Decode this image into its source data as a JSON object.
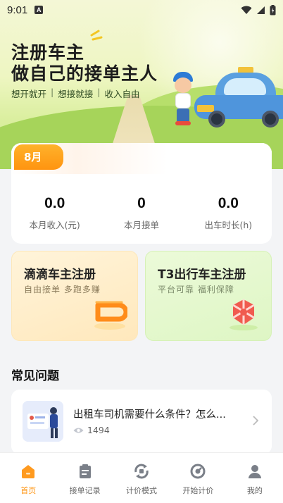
{
  "status_bar": {
    "time": "9:01",
    "notification_icon": "a-icon"
  },
  "hero": {
    "title_line1": "注册车主",
    "title_line2": "做自己的接单主人",
    "tags": [
      "想开就开",
      "想接就接",
      "收入自由"
    ],
    "separator": "|"
  },
  "stats": {
    "month": "8月",
    "items": [
      {
        "value": "0.0",
        "label": "本月收入(元)"
      },
      {
        "value": "0",
        "label": "本月接单"
      },
      {
        "value": "0.0",
        "label": "出车时长(h)"
      }
    ]
  },
  "registration": {
    "didi": {
      "name": "滴滴车主注册",
      "subtitle": "自由接单 多跑多赚"
    },
    "t3": {
      "name": "T3出行车主注册",
      "subtitle": "平台可靠 福利保障"
    }
  },
  "faq": {
    "title": "常见问题",
    "items": [
      {
        "question": "出租车司机需要什么条件？怎么...",
        "views": "1494"
      }
    ]
  },
  "nav": {
    "tabs": [
      {
        "label": "首页",
        "icon": "home-icon",
        "active": true
      },
      {
        "label": "接单记录",
        "icon": "clipboard-icon",
        "active": false
      },
      {
        "label": "计价模式",
        "icon": "pricing-mode-icon",
        "active": false
      },
      {
        "label": "开始计价",
        "icon": "meter-icon",
        "active": false
      },
      {
        "label": "我的",
        "icon": "user-icon",
        "active": false
      }
    ]
  },
  "colors": {
    "accent": "#ff9410",
    "nav_active": "#ff9410",
    "nav_inactive": "#666666"
  }
}
